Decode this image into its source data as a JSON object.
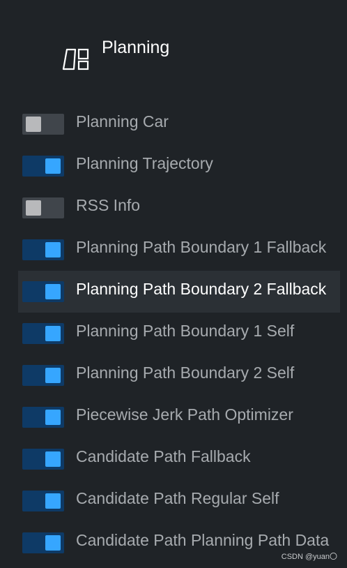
{
  "header": {
    "title": "Planning",
    "icon": "map-icon"
  },
  "layers": [
    {
      "label": "Planning Car",
      "enabled": false,
      "active": false
    },
    {
      "label": "Planning Trajectory",
      "enabled": true,
      "active": false
    },
    {
      "label": "RSS Info",
      "enabled": false,
      "active": false
    },
    {
      "label": "Planning Path Boundary 1 Fallback",
      "enabled": true,
      "active": false
    },
    {
      "label": "Planning Path Boundary 2 Fallback",
      "enabled": true,
      "active": true
    },
    {
      "label": "Planning Path Boundary 1 Self",
      "enabled": true,
      "active": false
    },
    {
      "label": "Planning Path Boundary 2 Self",
      "enabled": true,
      "active": false
    },
    {
      "label": "Piecewise Jerk Path Optimizer",
      "enabled": true,
      "active": false
    },
    {
      "label": "Candidate Path Fallback",
      "enabled": true,
      "active": false
    },
    {
      "label": "Candidate Path Regular Self",
      "enabled": true,
      "active": false
    },
    {
      "label": "Candidate Path Planning Path Data",
      "enabled": true,
      "active": false
    }
  ],
  "watermark": "CSDN @yuan〇",
  "colors": {
    "background": "#1f2327",
    "row_active": "#2b3035",
    "toggle_on_track": "#0e3a66",
    "toggle_on_knob": "#36a6ff",
    "toggle_off_track": "#40454b",
    "toggle_off_knob": "#b8b9bb",
    "label_text": "#a7abaf",
    "label_active_text": "#ffffff"
  }
}
